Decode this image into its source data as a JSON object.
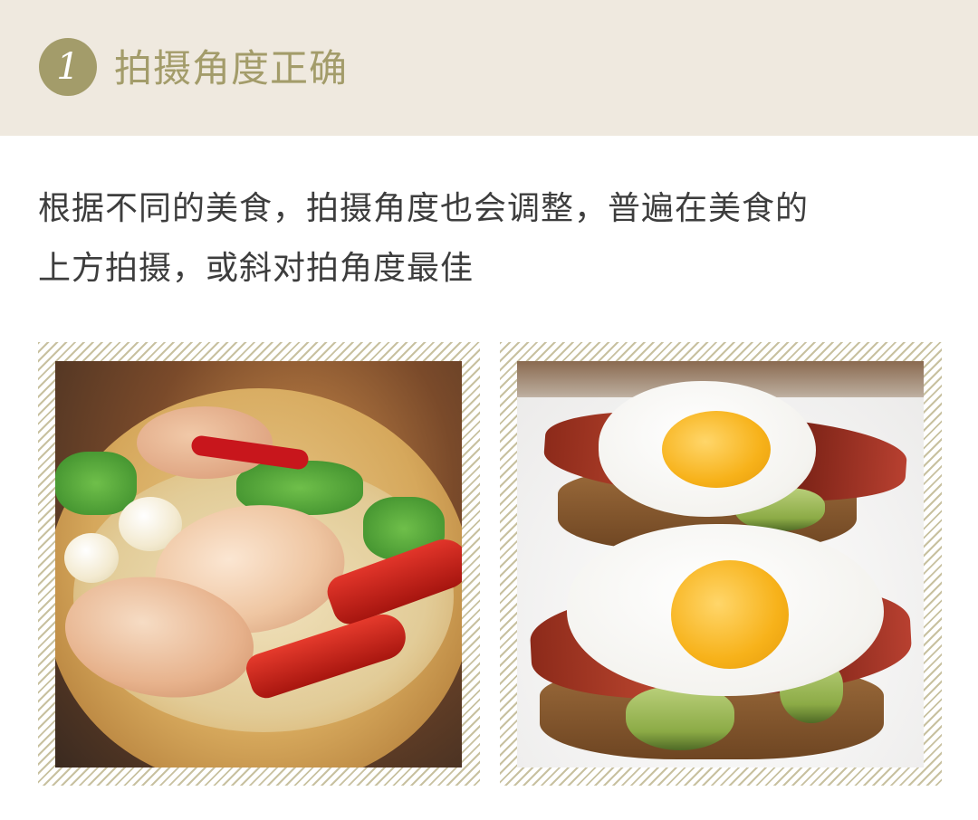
{
  "header": {
    "number": "1",
    "title": "拍摄角度正确"
  },
  "body": {
    "line1": "根据不同的美食，拍摄角度也会调整，普遍在美食的",
    "line2": "上方拍摄，或斜对拍角度最佳"
  },
  "colors": {
    "header_bg": "#efe9df",
    "accent": "#a39c6a",
    "body_text": "#3d3d3d"
  }
}
